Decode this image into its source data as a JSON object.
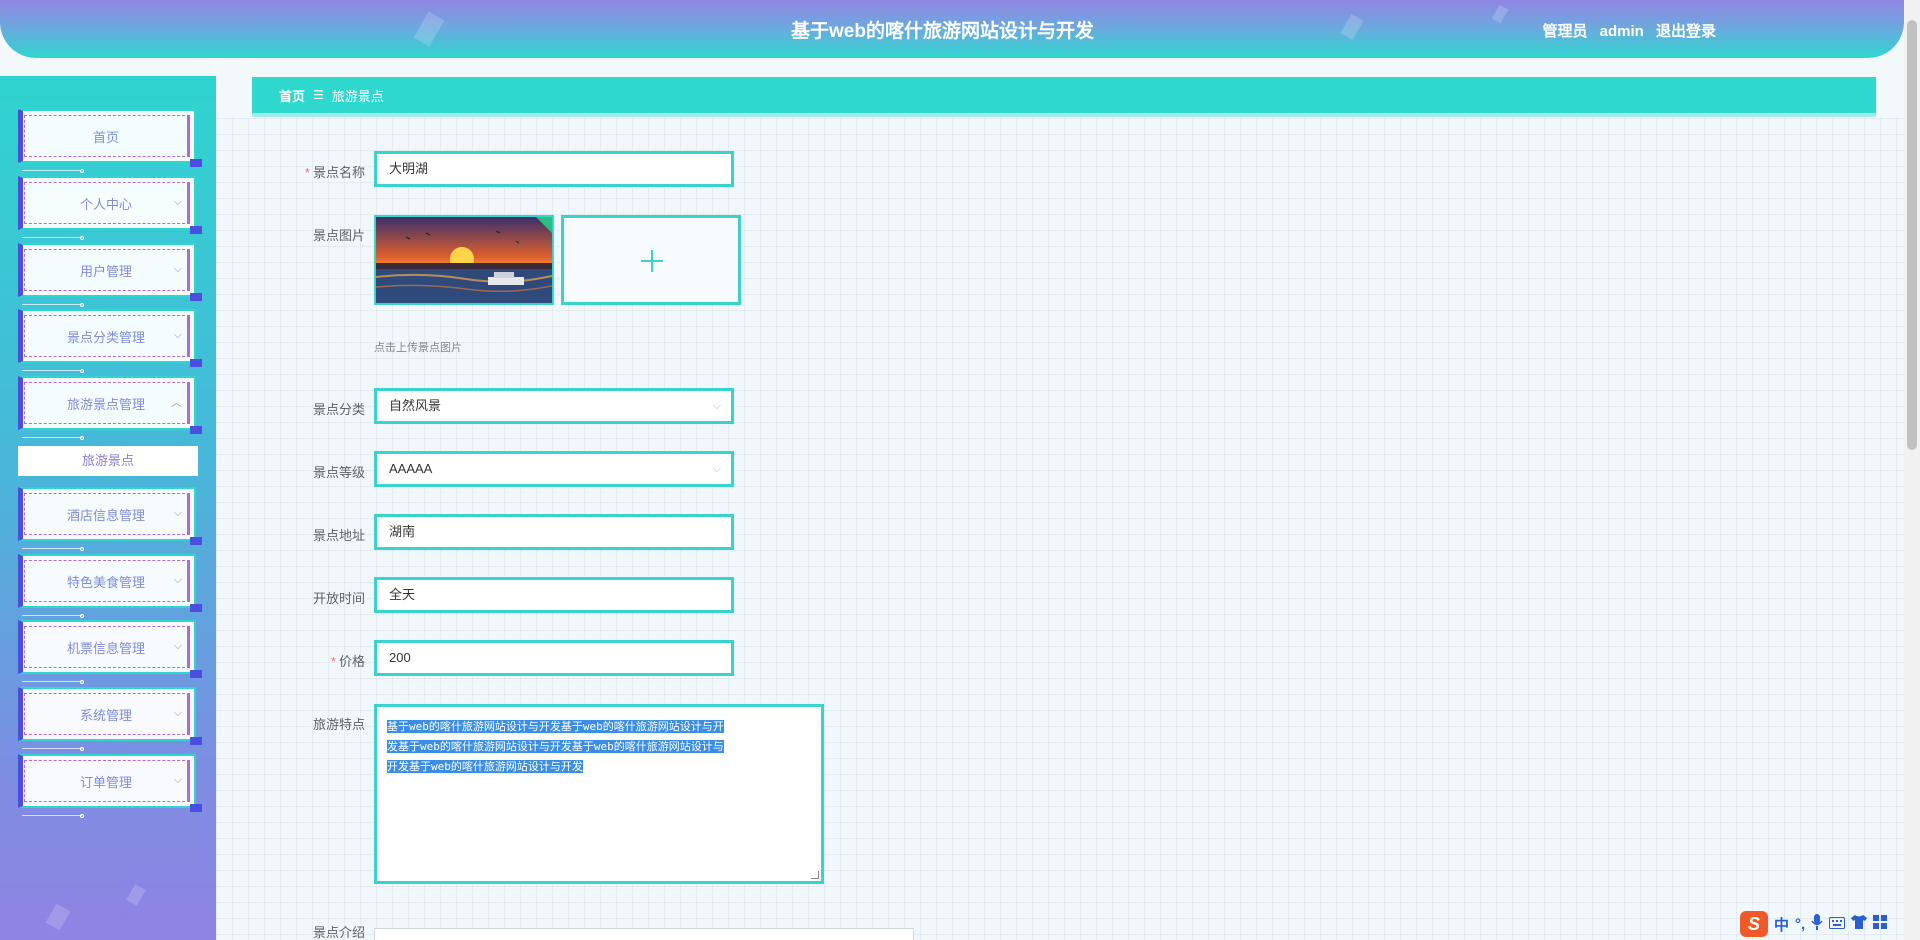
{
  "header": {
    "title": "基于web的喀什旅游网站设计与开发",
    "user_role": "管理员",
    "user_name": "admin",
    "logout_label": "退出登录"
  },
  "sidebar": {
    "items": [
      {
        "label": "首页",
        "has_chevron": false
      },
      {
        "label": "个人中心",
        "chevron": "⌵"
      },
      {
        "label": "用户管理",
        "chevron": "⌵"
      },
      {
        "label": "景点分类管理",
        "chevron": "⌵"
      },
      {
        "label": "旅游景点管理",
        "chevron": "︿"
      },
      {
        "label": "酒店信息管理",
        "chevron": "⌵"
      },
      {
        "label": "特色美食管理",
        "chevron": "⌵"
      },
      {
        "label": "机票信息管理",
        "chevron": "⌵"
      },
      {
        "label": "系统管理",
        "chevron": "⌵"
      },
      {
        "label": "订单管理",
        "chevron": "⌵"
      }
    ],
    "active_sub_item": "旅游景点"
  },
  "breadcrumb": {
    "home": "首页",
    "separator": "☰",
    "current": "旅游景点"
  },
  "form": {
    "name": {
      "label": "景点名称",
      "value": "大明湖",
      "required": true
    },
    "image": {
      "label": "景点图片",
      "tip": "点击上传景点图片",
      "add_glyph": "+"
    },
    "category": {
      "label": "景点分类",
      "value": "自然风景"
    },
    "level": {
      "label": "景点等级",
      "value": "AAAAA"
    },
    "address": {
      "label": "景点地址",
      "value": "湖南"
    },
    "open_time": {
      "label": "开放时间",
      "value": "全天"
    },
    "price": {
      "label": "价格",
      "value": "200",
      "required": true
    },
    "features": {
      "label": "旅游特点",
      "lines": [
        "基于web的喀什旅游网站设计与开发基于web的喀什旅游网站设计与开",
        "发基于web的喀什旅游网站设计与开发基于web的喀什旅游网站设计与",
        "开发基于web的喀什旅游网站设计与开发"
      ]
    },
    "intro": {
      "label": "景点介绍"
    }
  },
  "ime": {
    "logo": "S",
    "lang": "中",
    "punct": "°,",
    "icons": [
      "microphone-icon",
      "keyboard-icon",
      "shirt-icon",
      "grid-icon"
    ]
  },
  "colors": {
    "accent": "#2fd8cf",
    "menu_border": "#4b4ee0",
    "menu_dash": "#b06ad8",
    "required": "#f56c6c",
    "selection": "#3a8ee6"
  }
}
